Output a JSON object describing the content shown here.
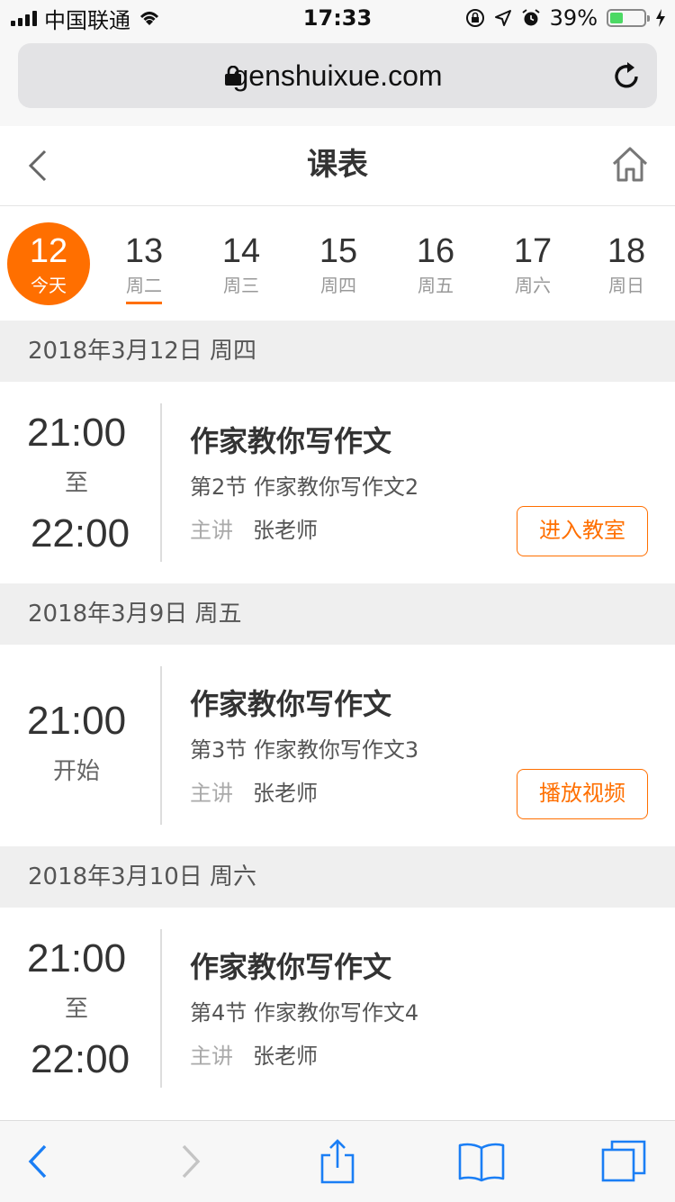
{
  "status_bar": {
    "carrier": "中国联通",
    "time": "17:33",
    "battery_percent": "39%",
    "battery_level": 0.39
  },
  "browser": {
    "url": "genshuixue.com"
  },
  "header": {
    "title": "课表"
  },
  "week": [
    {
      "day": "12",
      "weekday": "今天",
      "today": true
    },
    {
      "day": "13",
      "weekday": "周二",
      "selected": true
    },
    {
      "day": "14",
      "weekday": "周三"
    },
    {
      "day": "15",
      "weekday": "周四"
    },
    {
      "day": "16",
      "weekday": "周五"
    },
    {
      "day": "17",
      "weekday": "周六"
    },
    {
      "day": "18",
      "weekday": "周日"
    }
  ],
  "sections": [
    {
      "date": "2018年3月12日  周四",
      "course": {
        "start": "21:00",
        "mid": "至",
        "end": "22:00",
        "title": "作家教你写作文",
        "lesson": "第2节 作家教你写作文2",
        "teacher_label": "主讲",
        "teacher": "张老师",
        "action": "进入教室"
      }
    },
    {
      "date": "2018年3月9日  周五",
      "course": {
        "start": "21:00",
        "mid": "开始",
        "title": "作家教你写作文",
        "lesson": "第3节 作家教你写作文3",
        "teacher_label": "主讲",
        "teacher": "张老师",
        "action": "播放视频"
      }
    },
    {
      "date": "2018年3月10日  周六",
      "course": {
        "start": "21:00",
        "mid": "至",
        "end": "22:00",
        "title": "作家教你写作文",
        "lesson": "第4节 作家教你写作文4",
        "teacher_label": "主讲",
        "teacher": "张老师"
      }
    }
  ],
  "colors": {
    "accent": "#ff6f00",
    "ios_blue": "#1a7ef5"
  },
  "icons": [
    "back-icon",
    "home-icon",
    "lock-icon",
    "reload-icon",
    "share-icon",
    "bookmarks-icon",
    "tabs-icon"
  ]
}
